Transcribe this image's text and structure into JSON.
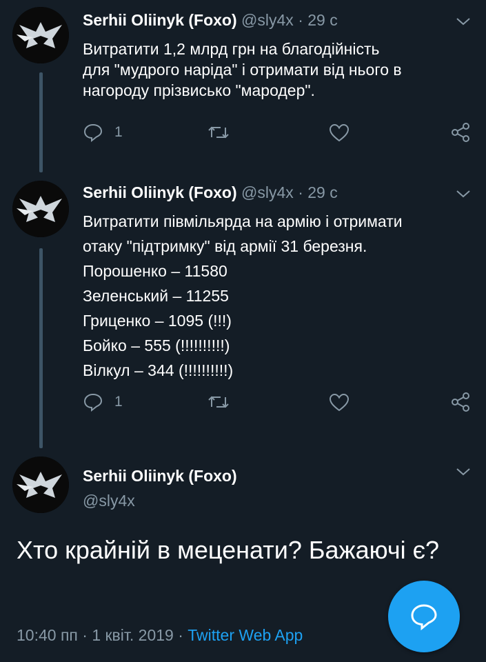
{
  "tweets": [
    {
      "name": "Serhii Oliinyk (Foxo)",
      "handle": "@sly4x",
      "separator": "·",
      "time": "29 с",
      "lines": [
        "Витратити 1,2 млрд грн на благодійність",
        "для \"мудрого наріда\" і отримати від нього в",
        "нагороду прізвисько \"мародер\"."
      ],
      "reply_count": "1"
    },
    {
      "name": "Serhii Oliinyk (Foxo)",
      "handle": "@sly4x",
      "separator": "·",
      "time": "29 с",
      "lines": [
        "Витратити півмільярда на армію і отримати",
        "отаку \"підтримку\" від армії 31 березня.",
        "Порошенко – 11580",
        "Зеленський – 11255",
        "Гриценко – 1095 (!!!)",
        "Бойко – 555 (!!!!!!!!!!)",
        "Вілкул – 344 (!!!!!!!!!!)"
      ],
      "reply_count": "1"
    }
  ],
  "main_tweet": {
    "name": "Serhii Oliinyk (Foxo)",
    "handle": "@sly4x",
    "text": "Хто крайній в меценати? Бажаючі є?",
    "timestamp": "10:40 пп",
    "separator1": "·",
    "date": "1 квіт. 2019",
    "separator2": "·",
    "source": "Twitter Web App"
  },
  "icons": {
    "reply": "reply-icon",
    "retweet": "retweet-icon",
    "like": "heart-icon",
    "share": "share-icon",
    "more": "chevron-down-icon",
    "compose": "compose-reply-icon"
  },
  "colors": {
    "background": "#141d26",
    "muted": "#8899a6",
    "accent": "#1da1f2",
    "thread_line": "#3d5466"
  }
}
